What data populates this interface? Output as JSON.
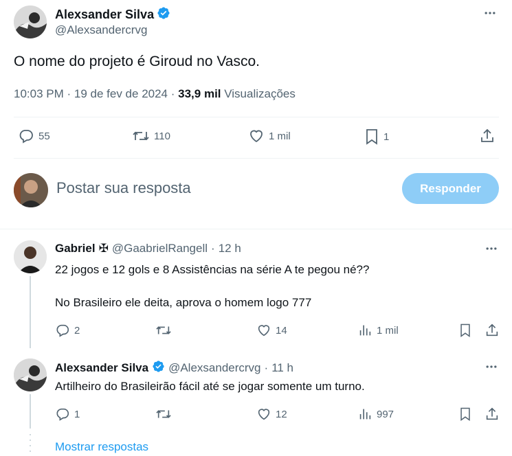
{
  "tweet": {
    "author_name": "Alexsander Silva",
    "author_handle": "@Alexsandercrvg",
    "text": "O nome do projeto é Giroud no Vasco.",
    "time": "10:03 PM",
    "date": "19 de fev de 2024",
    "views_count": "33,9 mil",
    "views_label": "Visualizações",
    "replies": "55",
    "reposts": "110",
    "likes": "1 mil",
    "bookmarks": "1"
  },
  "compose": {
    "placeholder": "Postar sua resposta",
    "button_label": "Responder"
  },
  "replies": [
    {
      "author_name": "Gabriel",
      "badge": "✠",
      "author_handle": "@GaabrielRangell",
      "age": "12 h",
      "text_line1": "22 jogos e 12 gols e 8 Assistências na série A te pegou né??",
      "text_line2": "No Brasileiro ele deita, aprova o homem logo 777",
      "replies": "2",
      "reposts": "",
      "likes": "14",
      "views": "1 mil"
    },
    {
      "author_name": "Alexsander Silva",
      "author_handle": "@Alexsandercrvg",
      "age": "11 h",
      "text_line1": "Artilheiro do Brasileirão fácil até se jogar somente um turno.",
      "replies": "1",
      "reposts": "",
      "likes": "12",
      "views": "997"
    }
  ],
  "show_replies_label": "Mostrar respostas",
  "colors": {
    "accent": "#1d9bf0",
    "muted": "#536471",
    "reply_button": "#8ecdf7"
  }
}
